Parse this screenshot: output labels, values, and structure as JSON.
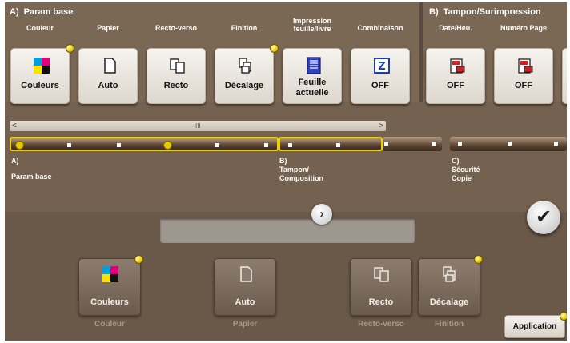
{
  "section_a": {
    "letter": "A)",
    "title": "Param base"
  },
  "section_b": {
    "letter": "B)",
    "title": "Tampon/Surimpression"
  },
  "top_buttons": [
    {
      "id": "couleur",
      "label": "Couleur",
      "value": "Couleurs",
      "icon": "color-cmyk-icon",
      "led": true
    },
    {
      "id": "papier",
      "label": "Papier",
      "value": "Auto",
      "icon": "paper-icon",
      "led": false
    },
    {
      "id": "recto-verso",
      "label": "Recto-verso",
      "value": "Recto",
      "icon": "duplex-icon",
      "led": false
    },
    {
      "id": "finition",
      "label": "Finition",
      "value": "Décalage",
      "icon": "finishing-icon",
      "led": true
    },
    {
      "id": "impression",
      "label_line1": "Impression",
      "label_line2": "feuille/livre",
      "value_line1": "Feuille",
      "value_line2": "actuelle",
      "icon": "sheet-print-icon",
      "led": false
    },
    {
      "id": "combinaison",
      "label": "Combinaison",
      "value": "OFF",
      "icon": "combine-icon",
      "led": false
    },
    {
      "id": "date-heure",
      "label": "Date/Heu.",
      "value": "OFF",
      "icon": "date-stamp-icon",
      "led": false
    },
    {
      "id": "numero-page",
      "label": "Numéro Page",
      "value": "OFF",
      "icon": "page-number-icon",
      "led": false
    }
  ],
  "scrollbar": {
    "left": "<",
    "right": ">",
    "grip": "III"
  },
  "groups": [
    {
      "id": "a",
      "line1": "A)",
      "line2": "Param base"
    },
    {
      "id": "b",
      "line1": "B)",
      "line2": "Tampon/",
      "line3": "Composition"
    },
    {
      "id": "c",
      "line1": "C)",
      "line2": "Sécurité",
      "line3": "Copie"
    }
  ],
  "nav": {
    "next": "›",
    "confirm": "✔"
  },
  "quick_buttons": [
    {
      "id": "q-couleur",
      "value": "Couleurs",
      "label": "Couleur",
      "icon": "color-cmyk-icon"
    },
    {
      "id": "q-papier",
      "value": "Auto",
      "label": "Papier",
      "icon": "paper-icon"
    },
    {
      "id": "q-recto",
      "value": "Recto",
      "label": "Recto-verso",
      "icon": "duplex-icon"
    },
    {
      "id": "q-finition",
      "value": "Décalage",
      "label": "Finition",
      "icon": "finishing-icon"
    }
  ],
  "application_button": "Application",
  "colors": {
    "led": "#e6c800",
    "panel": "#75614f",
    "button": "#f0ece5"
  }
}
